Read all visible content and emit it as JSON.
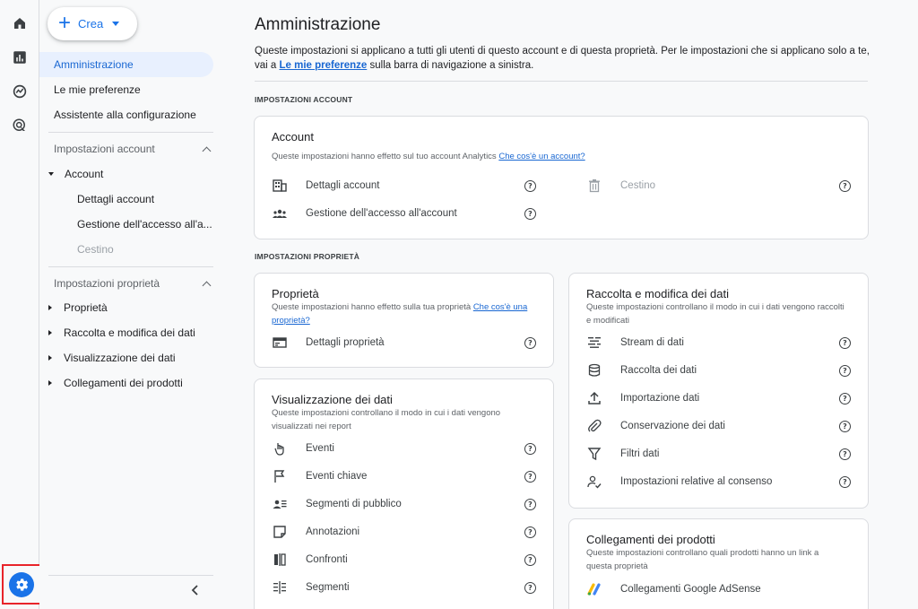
{
  "nav": {
    "create_label": "Crea",
    "items": [
      {
        "label": "Amministrazione"
      },
      {
        "label": "Le mie preferenze"
      },
      {
        "label": "Assistente alla configurazione"
      }
    ],
    "account_section": "Impostazioni account",
    "account_group": "Account",
    "account_children": [
      "Dettagli account",
      "Gestione dell'accesso all'a...",
      "Cestino"
    ],
    "property_section": "Impostazioni proprietà",
    "property_groups": [
      "Proprietà",
      "Raccolta e modifica dei dati",
      "Visualizzazione dei dati",
      "Collegamenti dei prodotti"
    ]
  },
  "main": {
    "title": "Amministrazione",
    "description_1": "Queste impostazioni si applicano a tutti gli utenti di questo account e di questa proprietà. Per le impostazioni che si applicano solo a te, vai a",
    "description_link": "Le mie preferenze",
    "description_2": "sulla barra di navigazione a sinistra.",
    "account_settings_label": "IMPOSTAZIONI ACCOUNT",
    "property_settings_label": "IMPOSTAZIONI PROPRIETÀ"
  },
  "account_card": {
    "title": "Account",
    "desc": "Queste impostazioni hanno effetto sul tuo account Analytics",
    "link": "Che cos'è un account?",
    "rows": [
      {
        "label": "Dettagli account",
        "icon": "building-icon"
      },
      {
        "label": "Gestione dell'accesso all'account",
        "icon": "group-icon"
      },
      {
        "label": "Cestino",
        "icon": "trash-icon"
      }
    ]
  },
  "property_card": {
    "title": "Proprietà",
    "desc": "Queste impostazioni hanno effetto sulla tua proprietà",
    "link": "Che cos'è una proprietà?",
    "rows": [
      {
        "label": "Dettagli proprietà",
        "icon": "card-icon"
      }
    ]
  },
  "display_card": {
    "title": "Visualizzazione dei dati",
    "desc": "Queste impostazioni controllano il modo in cui i dati vengono visualizzati nei report",
    "rows": [
      {
        "label": "Eventi",
        "icon": "touch-icon"
      },
      {
        "label": "Eventi chiave",
        "icon": "flag-icon"
      },
      {
        "label": "Segmenti di pubblico",
        "icon": "audience-icon"
      },
      {
        "label": "Annotazioni",
        "icon": "note-icon"
      },
      {
        "label": "Confronti",
        "icon": "compare-icon"
      },
      {
        "label": "Segmenti",
        "icon": "segments-icon"
      }
    ]
  },
  "collection_card": {
    "title": "Raccolta e modifica dei dati",
    "desc": "Queste impostazioni controllano il modo in cui i dati vengono raccolti e modificati",
    "rows": [
      {
        "label": "Stream di dati",
        "icon": "stream-icon"
      },
      {
        "label": "Raccolta dei dati",
        "icon": "database-icon"
      },
      {
        "label": "Importazione dati",
        "icon": "upload-icon"
      },
      {
        "label": "Conservazione dei dati",
        "icon": "clip-icon"
      },
      {
        "label": "Filtri dati",
        "icon": "filter-icon"
      },
      {
        "label": "Impostazioni relative al consenso",
        "icon": "consent-icon"
      }
    ]
  },
  "links_card": {
    "title": "Collegamenti dei prodotti",
    "desc": "Queste impostazioni controllano quali prodotti hanno un link a questa proprietà",
    "rows": [
      {
        "label": "Collegamenti Google AdSense",
        "icon": "adsense-icon"
      }
    ]
  },
  "help_glyph": "?",
  "colors": {
    "accent": "#1a73e8",
    "highlight": "#e8242a",
    "active_bg": "#e8f0fe"
  }
}
